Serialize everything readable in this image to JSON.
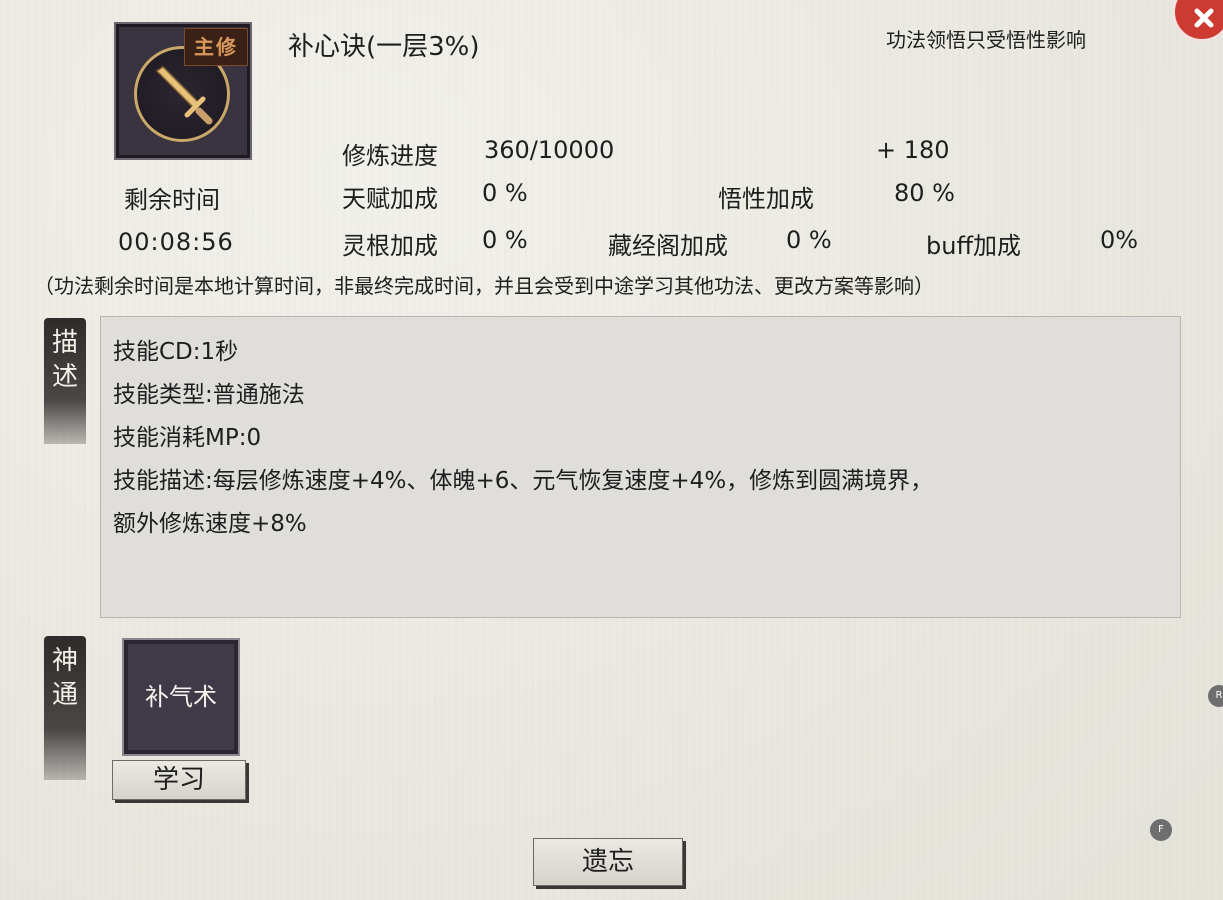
{
  "skill": {
    "icon": "sword-icon",
    "badge": "主修",
    "title": "补心诀(一层3%)"
  },
  "note_top": "功法领悟只受悟性影响",
  "progress": {
    "label": "修炼进度",
    "value": "360/10000",
    "gain": "+ 180"
  },
  "remaining": {
    "label": "剩余时间",
    "time": "00:08:56"
  },
  "bonuses": {
    "talent": {
      "label": "天赋加成",
      "value": "0 %"
    },
    "comprehension": {
      "label": "悟性加成",
      "value": "80 %"
    },
    "spirit_root": {
      "label": "灵根加成",
      "value": "0 %"
    },
    "library": {
      "label": "藏经阁加成",
      "value": "0 %"
    },
    "buff": {
      "label": "buff加成",
      "value": "0%"
    }
  },
  "disclaimer": "（功法剩余时间是本地计算时间，非最终完成时间，并且会受到中途学习其他功法、更改方案等影响）",
  "description_tab": "描述",
  "description": {
    "cd": "技能CD:1秒",
    "type": "技能类型:普通施法",
    "mp": "技能消耗MP:0",
    "effect_line1": "技能描述:每层修炼速度+4%、体魄+6、元气恢复速度+4%，修炼到圆满境界，",
    "effect_line2": "额外修炼速度+8%"
  },
  "shentong_tab": "神通",
  "shentong": {
    "card_label": "补气术",
    "learn_button": "学习"
  },
  "forget_button": "遗忘",
  "side_icons": {
    "r": "R",
    "f": "F"
  },
  "colors": {
    "close": "#cc3a32",
    "badge_bg": "#3b2015",
    "badge_text": "#d89a5c",
    "icon_bg": "#3a3340",
    "desc_bg": "#dfdedb"
  }
}
